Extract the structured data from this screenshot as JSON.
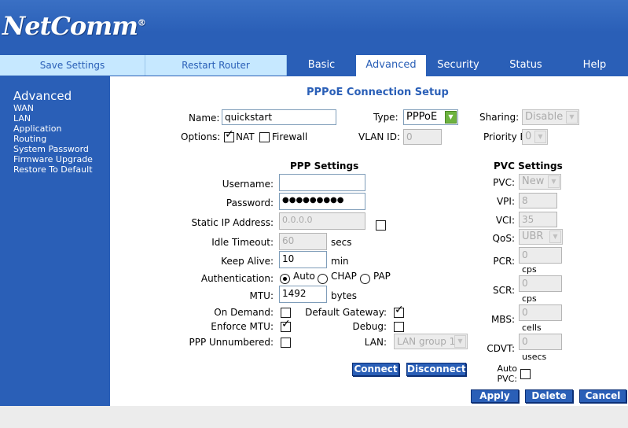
{
  "header": {
    "logo": "NetComm",
    "logo_reg": "®"
  },
  "nav": {
    "left_links": [
      "Save Settings",
      "Restart Router"
    ],
    "tabs": [
      {
        "label": "Basic",
        "active": false
      },
      {
        "label": "Advanced",
        "active": true
      },
      {
        "label": "Security",
        "active": false
      },
      {
        "label": "Status",
        "active": false
      },
      {
        "label": "Help",
        "active": false
      }
    ]
  },
  "sidebar": {
    "title": "Advanced",
    "links": [
      "WAN",
      "LAN",
      "Application",
      "Routing",
      "System Password",
      "Firmware Upgrade",
      "Restore To Default"
    ]
  },
  "page": {
    "title": "PPPoE Connection Setup",
    "name_label": "Name:",
    "name_value": "quickstart",
    "type_label": "Type:",
    "type_value": "PPPoE",
    "sharing_label": "Sharing:",
    "sharing_value": "Disable",
    "options_label": "Options:",
    "nat_label": "NAT",
    "firewall_label": "Firewall",
    "vlan_label": "VLAN ID:",
    "vlan_value": "0",
    "priority_label": "Priority Bits:",
    "priority_value": "0"
  },
  "ppp": {
    "title": "PPP Settings",
    "username_label": "Username:",
    "username_value": "",
    "password_label": "Password:",
    "password_value": "●●●●●●●●●",
    "static_ip_label": "Static IP Address:",
    "static_ip_value": "0.0.0.0",
    "idle_label": "Idle Timeout:",
    "idle_value": "60",
    "idle_unit": "secs",
    "keepalive_label": "Keep Alive:",
    "keepalive_value": "10",
    "keepalive_unit": "min",
    "auth_label": "Authentication:",
    "auth_options": [
      "Auto",
      "CHAP",
      "PAP"
    ],
    "mtu_label": "MTU:",
    "mtu_value": "1492",
    "mtu_unit": "bytes",
    "ondemand_label": "On Demand:",
    "default_gw_label": "Default Gateway:",
    "enforce_mtu_label": "Enforce MTU:",
    "debug_label": "Debug:",
    "unnumbered_label": "PPP Unnumbered:",
    "lan_label": "LAN:",
    "lan_value": "LAN group 1",
    "connect_label": "Connect",
    "disconnect_label": "Disconnect"
  },
  "pvc": {
    "title": "PVC Settings",
    "pvc_label": "PVC:",
    "pvc_value": "New",
    "vpi_label": "VPI:",
    "vpi_value": "8",
    "vci_label": "VCI:",
    "vci_value": "35",
    "qos_label": "QoS:",
    "qos_value": "UBR",
    "pcr_label": "PCR:",
    "pcr_value": "0",
    "pcr_unit": "cps",
    "scr_label": "SCR:",
    "scr_value": "0",
    "scr_unit": "cps",
    "mbs_label": "MBS:",
    "mbs_value": "0",
    "mbs_unit": "cells",
    "cdvt_label": "CDVT:",
    "cdvt_value": "0",
    "cdvt_unit": "usecs",
    "auto_label_1": "Auto",
    "auto_label_2": "PVC:"
  },
  "actions": {
    "apply": "Apply",
    "delete": "Delete",
    "cancel": "Cancel"
  },
  "colors": {
    "brand_blue": "#2a5fb7",
    "light_nav": "#c6e8ff"
  }
}
